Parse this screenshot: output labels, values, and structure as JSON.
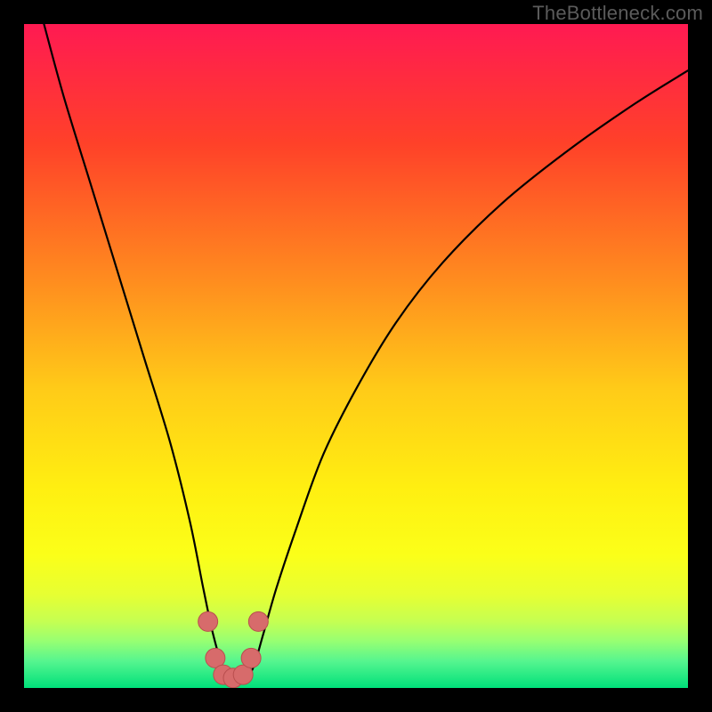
{
  "watermark": "TheBottleneck.com",
  "chart_data": {
    "type": "line",
    "title": "",
    "xlabel": "",
    "ylabel": "",
    "xlim": [
      0,
      100
    ],
    "ylim": [
      0,
      100
    ],
    "series": [
      {
        "name": "curve",
        "x": [
          3,
          6,
          10,
          14,
          18,
          22,
          25,
          27,
          28.5,
          30,
          31.5,
          33,
          34.5,
          36,
          38,
          41,
          45,
          50,
          56,
          63,
          72,
          82,
          92,
          100
        ],
        "y": [
          100,
          89,
          76,
          63,
          50,
          37,
          25,
          15,
          8,
          3,
          1,
          1,
          3,
          8,
          15,
          24,
          35,
          45,
          55,
          64,
          73,
          81,
          88,
          93
        ]
      }
    ],
    "scatter_overlay": {
      "name": "marker-cluster",
      "x": [
        27.7,
        28.8,
        30.0,
        31.5,
        33.0,
        34.2,
        35.3
      ],
      "y": [
        10.0,
        4.5,
        2.0,
        1.5,
        2.0,
        4.5,
        10.0
      ]
    },
    "gradient_stops": [
      {
        "offset": 0.0,
        "color": "#ff1a52"
      },
      {
        "offset": 0.18,
        "color": "#ff4129"
      },
      {
        "offset": 0.38,
        "color": "#ff8a1f"
      },
      {
        "offset": 0.55,
        "color": "#ffcb18"
      },
      {
        "offset": 0.7,
        "color": "#ffef11"
      },
      {
        "offset": 0.8,
        "color": "#fbff19"
      },
      {
        "offset": 0.86,
        "color": "#e6ff33"
      },
      {
        "offset": 0.9,
        "color": "#c5ff52"
      },
      {
        "offset": 0.93,
        "color": "#96ff73"
      },
      {
        "offset": 0.96,
        "color": "#55f58f"
      },
      {
        "offset": 1.0,
        "color": "#00e07a"
      }
    ]
  }
}
